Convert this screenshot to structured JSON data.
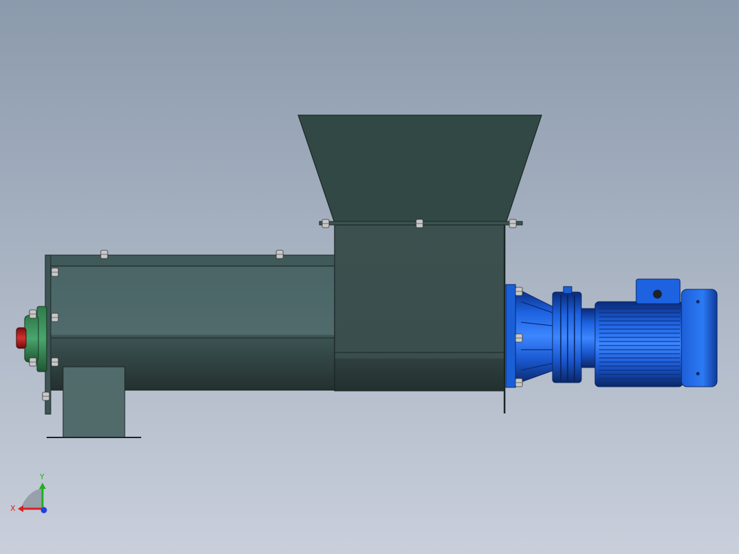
{
  "viewport": {
    "background_top": "#8b9aac",
    "background_bottom": "#c9cfdb"
  },
  "colors": {
    "hopper": "#324844",
    "trough_upper": "#506b6b",
    "trough_lower": "#2c3e3e",
    "end_plate": "#3d5555",
    "bearing_green": "#3b8a5a",
    "red_cap": "#b22222",
    "motor_blue": "#1a5fd6",
    "motor_dark": "#0c2f7a",
    "bolt": "#c8c8c8"
  },
  "triad": {
    "x_label": "X",
    "y_label": "Y",
    "x_color": "#d92020",
    "y_color": "#1db21d",
    "z_color": "#2040e0"
  }
}
